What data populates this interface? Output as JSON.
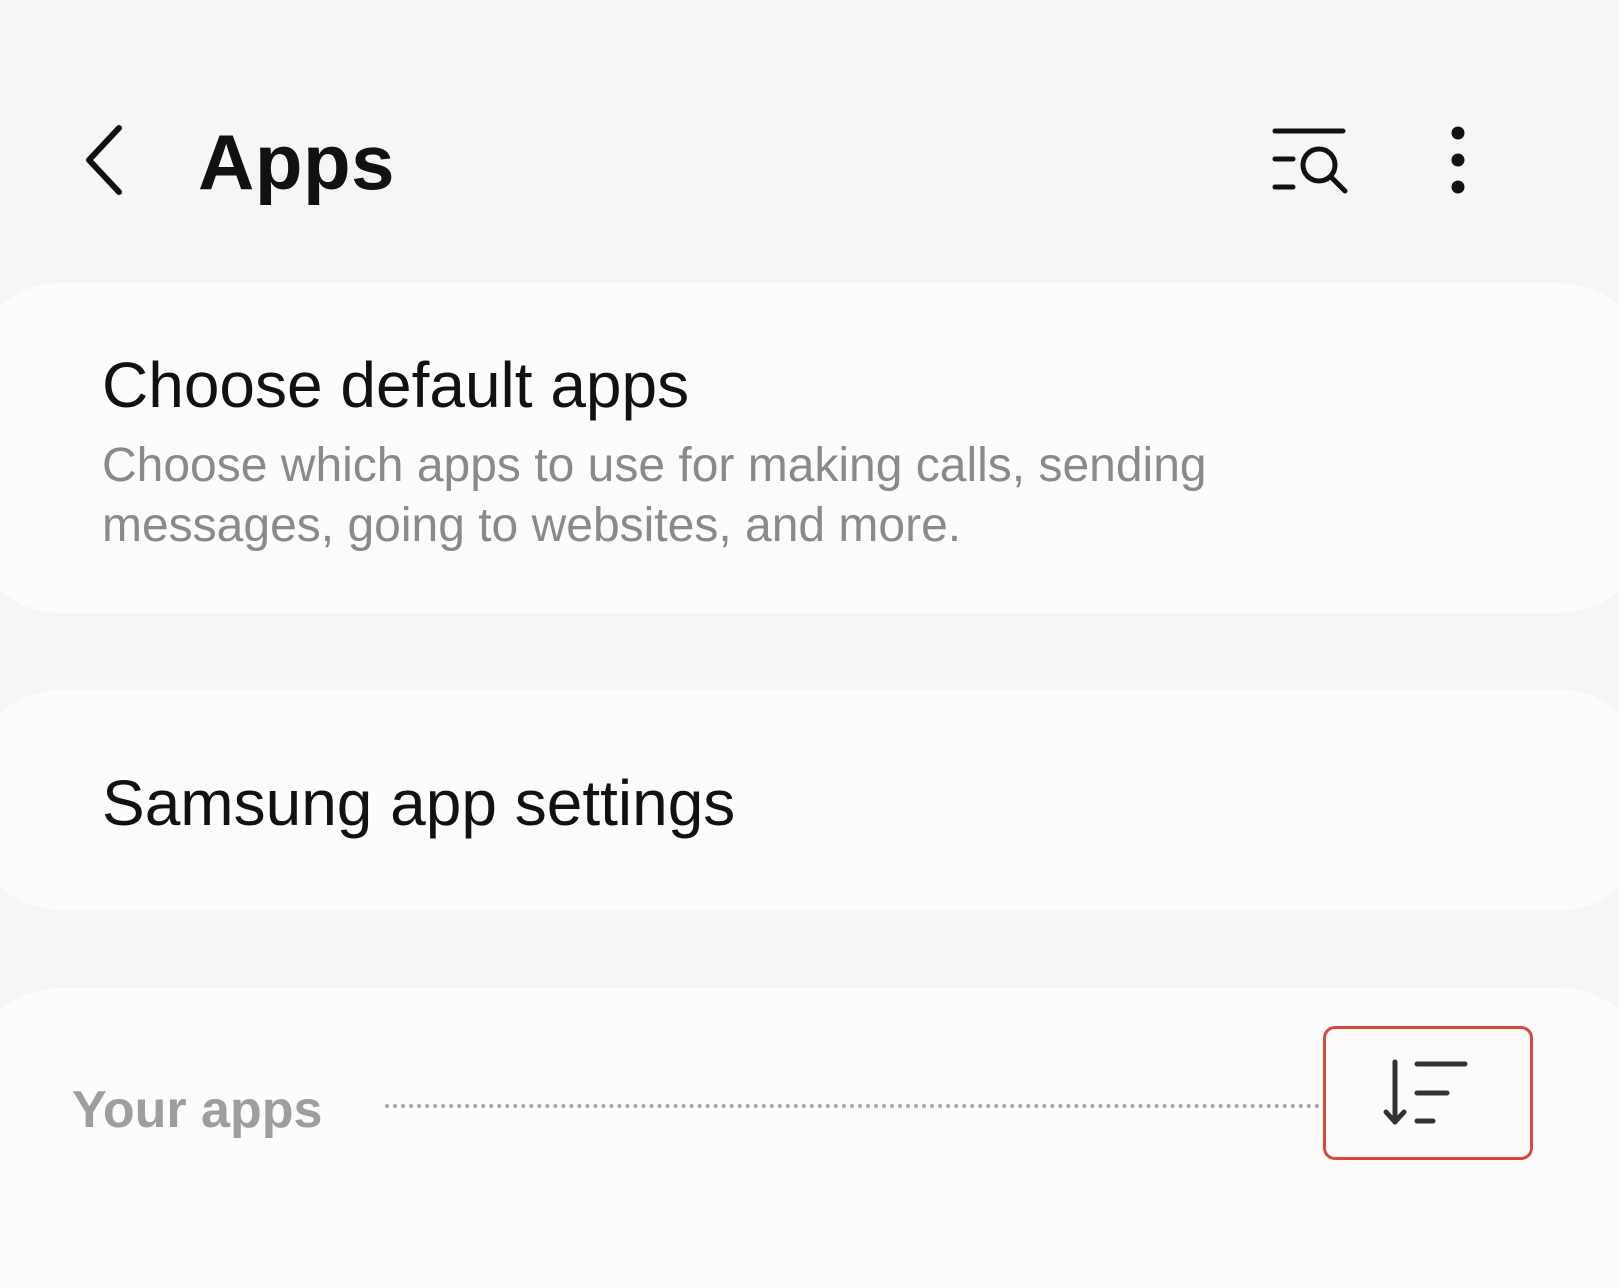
{
  "header": {
    "title": "Apps",
    "back_icon": "chevron-left-icon",
    "search_icon": "list-search-icon",
    "more_icon": "more-vertical-icon"
  },
  "cards": {
    "default_apps": {
      "title": "Choose default apps",
      "subtitle": "Choose which apps to use for making calls, sending messages, going to websites, and more."
    },
    "samsung_settings": {
      "title": "Samsung app settings"
    }
  },
  "your_apps": {
    "label": "Your apps",
    "sort_icon": "sort-icon"
  },
  "colors": {
    "background": "#f6f6f6",
    "card": "#fcfcfc",
    "primary_text": "#111111",
    "secondary_text": "#8a8a8a",
    "highlight": "#e0453c"
  }
}
